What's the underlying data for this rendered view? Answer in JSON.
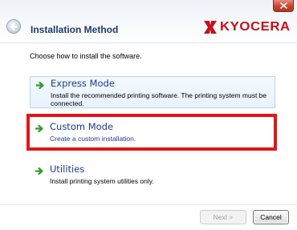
{
  "window": {
    "title": "Installation Method",
    "brand": "KYOCERA"
  },
  "instruction": "Choose how to install the software.",
  "options": [
    {
      "label": "Express Mode",
      "description": "Install the recommended printing software. The printing system must be connected."
    },
    {
      "label": "Custom Mode",
      "description": "Create a custom installation."
    },
    {
      "label": "Utilities",
      "description": "Install printing system utilities only."
    }
  ],
  "buttons": {
    "next": "Next >",
    "cancel": "Cancel"
  },
  "colors": {
    "brand_red": "#c4121a",
    "highlight": "#e3141a",
    "arrow_green": "#2e9e2a",
    "link_blue": "#1f3a8a"
  }
}
